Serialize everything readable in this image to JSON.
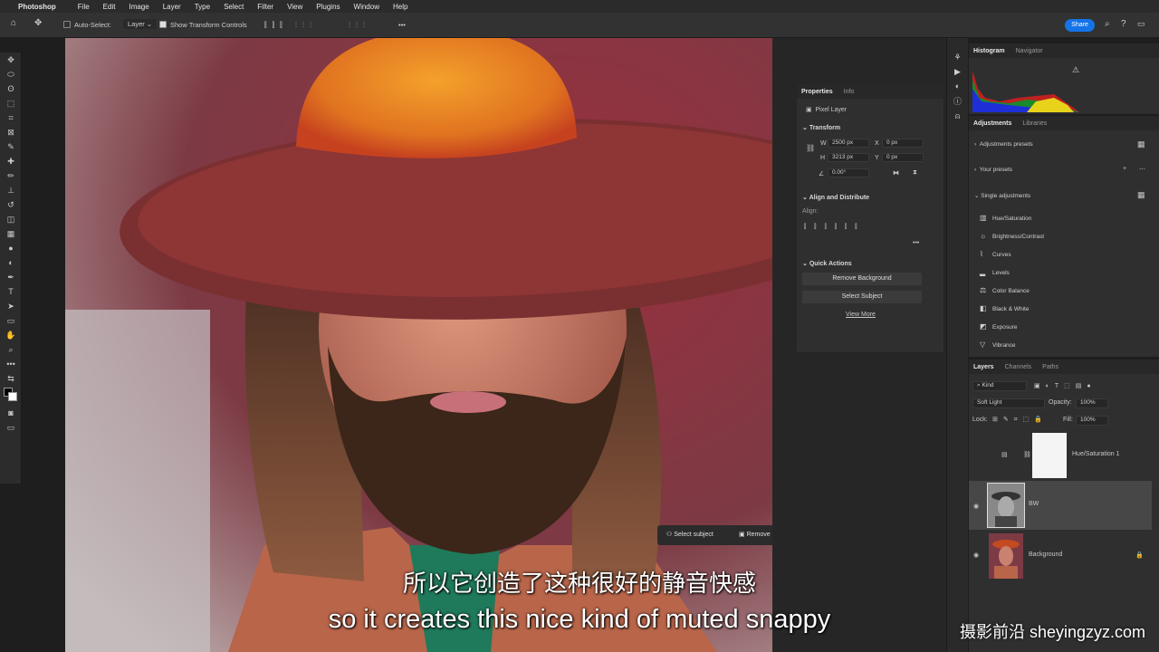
{
  "menubar": {
    "app": "Photoshop",
    "items": [
      "File",
      "Edit",
      "Image",
      "Layer",
      "Type",
      "Select",
      "Filter",
      "View",
      "Plugins",
      "Window",
      "Help"
    ]
  },
  "options": {
    "auto_select": "Auto-Select:",
    "auto_select_value": "Layer",
    "show_transform": "Show Transform Controls",
    "share": "Share"
  },
  "properties": {
    "tabs": [
      "Properties",
      "Info"
    ],
    "kind": "Pixel Layer",
    "transform_title": "Transform",
    "w_label": "W",
    "w_value": "2500 px",
    "h_label": "H",
    "h_value": "3213 px",
    "x_label": "X",
    "x_value": "0 px",
    "y_label": "Y",
    "y_value": "0 px",
    "angle": "0.00°",
    "align_title": "Align and Distribute",
    "align_label": "Align:",
    "quick_title": "Quick Actions",
    "remove_bg": "Remove Background",
    "select_subject": "Select Subject",
    "view_more": "View More"
  },
  "histogram": {
    "tabs": [
      "Histogram",
      "Navigator"
    ]
  },
  "adjustments": {
    "tabs": [
      "Adjustments",
      "Libraries"
    ],
    "presets": "Adjustments presets",
    "your_presets": "Your presets",
    "single": "Single adjustments",
    "items": [
      "Hue/Saturation",
      "Brightness/Contrast",
      "Curves",
      "Levels",
      "Color Balance",
      "Black & White",
      "Exposure",
      "Vibrance"
    ]
  },
  "layers": {
    "tabs": [
      "Layers",
      "Channels",
      "Paths"
    ],
    "filter": "Kind",
    "blend": "Soft Light",
    "opacity_label": "Opacity:",
    "opacity": "100%",
    "lock_label": "Lock:",
    "fill_label": "Fill:",
    "fill": "100%",
    "rows": [
      "Hue/Saturation 1",
      "BW",
      "Background"
    ]
  },
  "taskbar": {
    "select_subject": "Select subject",
    "remove_background": "Remove background"
  },
  "subtitles": {
    "zh": "所以它创造了这种很好的静音快感",
    "en": "so it creates this nice kind of muted snappy"
  },
  "watermark": "摄影前沿 sheyingzyz.com"
}
